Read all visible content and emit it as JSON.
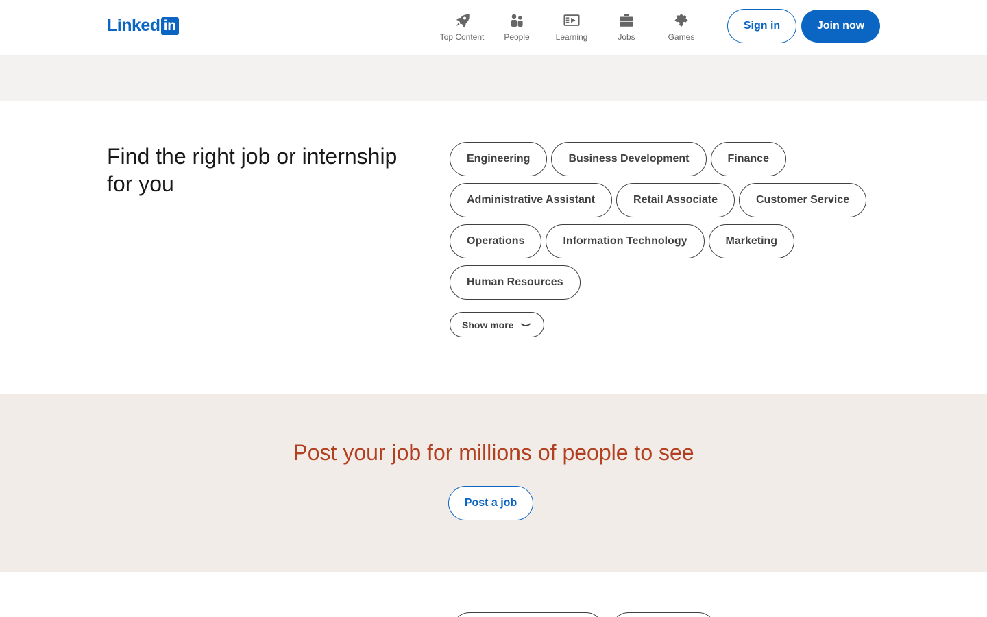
{
  "header": {
    "logo_text": "Linked",
    "logo_box_text": "in",
    "nav": [
      {
        "label": "Top Content",
        "icon": "rocket-icon"
      },
      {
        "label": "People",
        "icon": "people-icon"
      },
      {
        "label": "Learning",
        "icon": "learning-icon"
      },
      {
        "label": "Jobs",
        "icon": "briefcase-icon"
      },
      {
        "label": "Games",
        "icon": "puzzle-icon"
      }
    ],
    "sign_in": "Sign in",
    "join_now": "Join now"
  },
  "jobs": {
    "title": "Find the right job or internship for you",
    "categories": [
      [
        "Engineering",
        "Business Development",
        "Finance"
      ],
      [
        "Administrative Assistant",
        "Retail Associate",
        "Customer Service"
      ],
      [
        "Operations",
        "Information Technology",
        "Marketing"
      ],
      [
        "Human Resources"
      ]
    ],
    "show_more": "Show more"
  },
  "post": {
    "title": "Post your job for millions of people to see",
    "button": "Post a job"
  },
  "colors": {
    "brand": "#0a66c2",
    "post_title": "#b24020",
    "band_gray": "#f3f2f0",
    "band_warm": "#f1ece7"
  }
}
